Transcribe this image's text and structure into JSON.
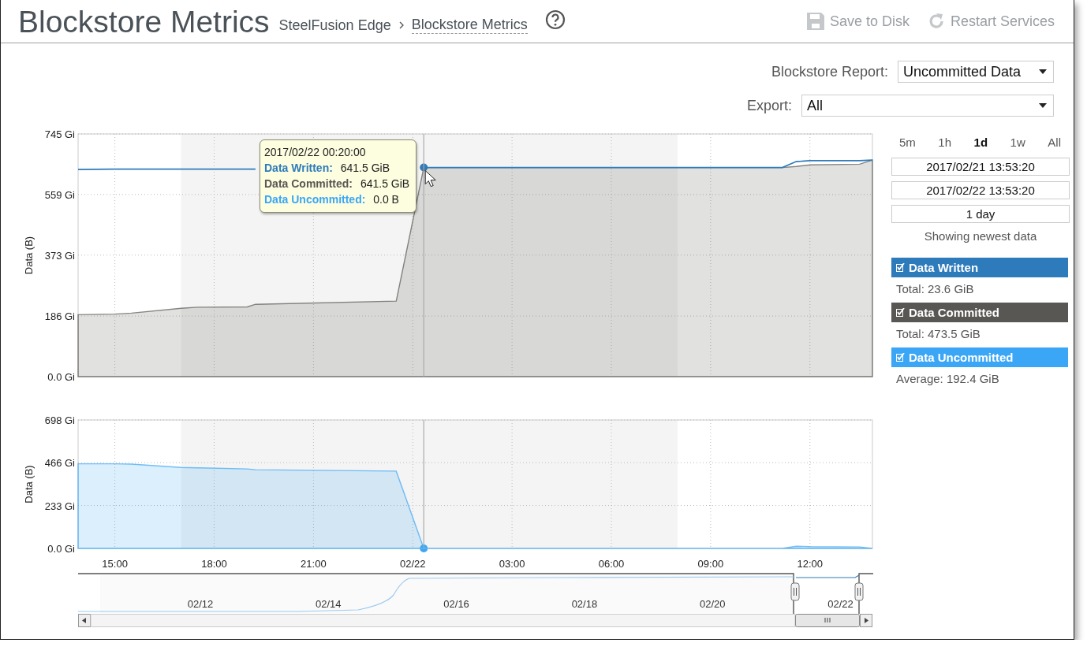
{
  "header": {
    "title": "Blockstore Metrics",
    "breadcrumb": [
      {
        "label": "SteelFusion Edge",
        "current": false
      },
      {
        "label": "Blockstore Metrics",
        "current": true
      }
    ],
    "actions": [
      {
        "label": "Save to Disk",
        "kind": "save",
        "disabled": true
      },
      {
        "label": "Restart Services",
        "kind": "restart",
        "disabled": true
      }
    ]
  },
  "controls": [
    {
      "label": "Blockstore Report:",
      "value": "Uncommitted Data"
    },
    {
      "label": "Export:",
      "value": "All"
    }
  ],
  "charts": [
    {
      "chart_data": {
        "type": "area",
        "ylabel": "Data (B)",
        "grid": true,
        "x": [
          "2017-02-21T13:53:20",
          "2017-02-21T15:00:00",
          "2017-02-21T15:30:00",
          "2017-02-21T17:00:00",
          "2017-02-21T17:30:00",
          "2017-02-21T19:00:00",
          "2017-02-21T19:15:00",
          "2017-02-21T23:30:00",
          "2017-02-22T00:20:00",
          "2017-02-22T06:00:00",
          "2017-02-22T11:10:00",
          "2017-02-22T11:35:00",
          "2017-02-22T12:00:00",
          "2017-02-22T13:30:00",
          "2017-02-22T13:53:20"
        ],
        "series": [
          {
            "type": "area",
            "color": "#595753",
            "values": [
              190,
              192,
              195,
              210,
              213,
              214,
              222,
              232,
              642,
              642,
              642,
              645,
              650,
              652,
              665
            ]
          },
          {
            "type": "line",
            "color": "#2e7bbb",
            "values": [
              636,
              637,
              637,
              637,
              637,
              637,
              637,
              null,
              642,
              642,
              642,
              660,
              663,
              663,
              665
            ]
          }
        ],
        "xlim": [
          "2017-02-21T13:53:20",
          "2017-02-22T13:53:20"
        ],
        "ylim": [
          0,
          745
        ],
        "yticks": [
          {
            "value": 0,
            "label": "0.0 Gi"
          },
          {
            "value": 186,
            "label": "186 Gi"
          },
          {
            "value": 373,
            "label": "373 Gi"
          },
          {
            "value": 559,
            "label": "559 Gi"
          },
          {
            "value": 745,
            "label": "745 Gi"
          }
        ]
      },
      "tooltip": {
        "title": "2017/02/22 00:20:00",
        "rows": [
          {
            "label": "Data Written:",
            "value": "641.5 GiB",
            "color": "#2e7bbb"
          },
          {
            "label": "Data Committed:",
            "value": "641.5 GiB",
            "color": "#595753"
          },
          {
            "label": "Data Uncommitted:",
            "value": "0.0 B",
            "color": "#3ba6f5"
          }
        ]
      }
    },
    {
      "chart_data": {
        "type": "area",
        "ylabel": "Data (B)",
        "grid": true,
        "x": [
          "2017-02-21T13:53:20",
          "2017-02-21T15:00:00",
          "2017-02-21T15:30:00",
          "2017-02-21T17:00:00",
          "2017-02-21T17:30:00",
          "2017-02-21T19:00:00",
          "2017-02-21T19:15:00",
          "2017-02-21T23:30:00",
          "2017-02-22T00:20:00",
          "2017-02-22T06:00:00",
          "2017-02-22T11:10:00",
          "2017-02-22T11:35:00",
          "2017-02-22T12:00:00",
          "2017-02-22T13:30:00",
          "2017-02-22T13:53:20"
        ],
        "series": [
          {
            "color": "#3ba6f5",
            "values": [
              460,
              460,
              458,
              440,
              438,
              432,
              428,
              420,
              0,
              0,
              0,
              12,
              10,
              8,
              0
            ]
          }
        ],
        "xlim": [
          "2017-02-21T13:53:20",
          "2017-02-22T13:53:20"
        ],
        "ylim": [
          0,
          698
        ],
        "xticks": [
          {
            "value": "2017-02-21T15:00:00",
            "label": "15:00"
          },
          {
            "value": "2017-02-21T18:00:00",
            "label": "18:00"
          },
          {
            "value": "2017-02-21T21:00:00",
            "label": "21:00"
          },
          {
            "value": "2017-02-22T00:00:00",
            "label": "02/22"
          },
          {
            "value": "2017-02-22T03:00:00",
            "label": "03:00"
          },
          {
            "value": "2017-02-22T06:00:00",
            "label": "06:00"
          },
          {
            "value": "2017-02-22T09:00:00",
            "label": "09:00"
          },
          {
            "value": "2017-02-22T12:00:00",
            "label": "12:00"
          }
        ],
        "yticks": [
          {
            "value": 0,
            "label": "0.0 Gi"
          },
          {
            "value": 233,
            "label": "233 Gi"
          },
          {
            "value": 466,
            "label": "466 Gi"
          },
          {
            "value": 698,
            "label": "698 Gi"
          }
        ]
      }
    }
  ],
  "navigator": {
    "labels": [
      "02/12",
      "02/14",
      "02/16",
      "02/18",
      "02/20",
      "02/22"
    ]
  },
  "range": {
    "buttons": [
      {
        "label": "5m",
        "selected": false
      },
      {
        "label": "1h",
        "selected": false
      },
      {
        "label": "1d",
        "selected": true
      },
      {
        "label": "1w",
        "selected": false
      },
      {
        "label": "All",
        "selected": false
      }
    ],
    "start": "2017/02/21 13:53:20",
    "end": "2017/02/22 13:53:20",
    "duration": "1 day",
    "note": "Showing newest data"
  },
  "legend": [
    {
      "label": "Data Written",
      "checked": true,
      "color": "#2e7bbb",
      "stat": "Total: 23.6 GiB"
    },
    {
      "label": "Data Committed",
      "checked": true,
      "color": "#595753",
      "stat": "Total: 473.5 GiB"
    },
    {
      "label": "Data Uncommitted",
      "checked": true,
      "color": "#3ba6f5",
      "stat": "Average: 192.4 GiB"
    }
  ]
}
